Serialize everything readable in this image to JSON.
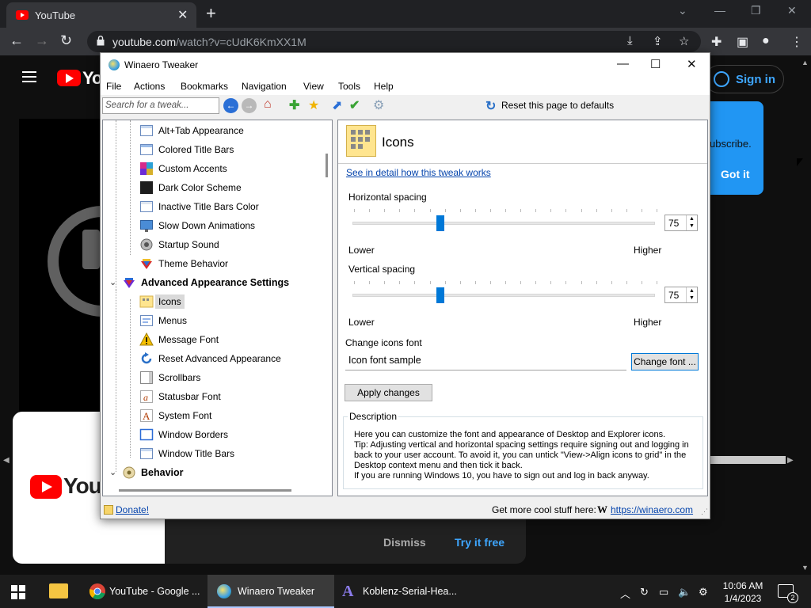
{
  "browser": {
    "tab_title": "YouTube",
    "url_host": "youtube.com",
    "url_path": "/watch?v=cUdK6KmXX1M"
  },
  "youtube": {
    "logo_text": "Yo",
    "signin_label": "Sign in",
    "tip_text": "ubscribe.",
    "tip_button": "Got it",
    "promo_logo_text": "YouTu",
    "dismiss_label": "Dismiss",
    "try_free_label": "Try it free"
  },
  "app": {
    "title": "Winaero Tweaker",
    "menu": [
      "File",
      "Actions",
      "Bookmarks",
      "Navigation",
      "View",
      "Tools",
      "Help"
    ],
    "search_placeholder": "Search for a tweak...",
    "reset_label": "Reset this page to defaults",
    "tree": {
      "items": [
        {
          "label": "Alt+Tab Appearance",
          "icon": "window-icon"
        },
        {
          "label": "Colored Title Bars",
          "icon": "window-icon"
        },
        {
          "label": "Custom Accents",
          "icon": "palette-icon"
        },
        {
          "label": "Dark Color Scheme",
          "icon": "dark-scheme-icon"
        },
        {
          "label": "Inactive Title Bars Color",
          "icon": "window-icon"
        },
        {
          "label": "Slow Down Animations",
          "icon": "monitor-icon"
        },
        {
          "label": "Startup Sound",
          "icon": "speaker-icon"
        },
        {
          "label": "Theme Behavior",
          "icon": "paint-icon"
        }
      ],
      "category_advanced": "Advanced Appearance Settings",
      "advanced_items": [
        {
          "label": "Icons",
          "icon": "icons-folder-icon",
          "selected": true
        },
        {
          "label": "Menus",
          "icon": "menu-icon"
        },
        {
          "label": "Message Font",
          "icon": "warning-icon"
        },
        {
          "label": "Reset Advanced Appearance",
          "icon": "reset-icon"
        },
        {
          "label": "Scrollbars",
          "icon": "scrollbar-icon"
        },
        {
          "label": "Statusbar Font",
          "icon": "font-icon"
        },
        {
          "label": "System Font",
          "icon": "font-icon"
        },
        {
          "label": "Window Borders",
          "icon": "window-icon"
        },
        {
          "label": "Window Title Bars",
          "icon": "window-icon"
        }
      ],
      "category_behavior": "Behavior"
    },
    "page": {
      "title": "Icons",
      "detail_link": "See in detail how this tweak works",
      "horizontal_label": "Horizontal spacing",
      "horizontal_value": "75",
      "horizontal_level": 0.29,
      "vertical_label": "Vertical spacing",
      "vertical_value": "75",
      "vertical_level": 0.29,
      "lower_label": "Lower",
      "higher_label": "Higher",
      "font_label": "Change icons font",
      "font_sample": "Icon font sample",
      "change_font_button": "Change font ...",
      "apply_button": "Apply changes",
      "description_legend": "Description",
      "description_lines": [
        "Here you can customize the font and appearance of Desktop and Explorer icons.",
        "Tip: Adjusting vertical and horizontal spacing settings require signing out and logging in",
        "back to your user account. To avoid it, you can untick \"View->Align icons to grid\" in the",
        "Desktop context menu and then tick it back.",
        "If you are running Windows 10, you have to sign out and log in back anyway."
      ]
    },
    "status": {
      "donate_label": "Donate!",
      "more_label": "Get more cool stuff here:",
      "site_link": "https://winaero.com"
    }
  },
  "taskbar": {
    "items": [
      {
        "label": "YouTube - Google ...",
        "icon": "chrome-icon"
      },
      {
        "label": "Winaero Tweaker",
        "icon": "winaero-icon",
        "active": true
      },
      {
        "label": "Koblenz-Serial-Hea...",
        "icon": "font-app-icon"
      }
    ],
    "time": "10:06 AM",
    "date": "1/4/2023",
    "notification_count": "2"
  },
  "colors": {
    "youtube_red": "#ff0000",
    "accent_blue": "#0078d7",
    "link_blue": "#0645ad",
    "yt_link": "#3ea6ff"
  }
}
